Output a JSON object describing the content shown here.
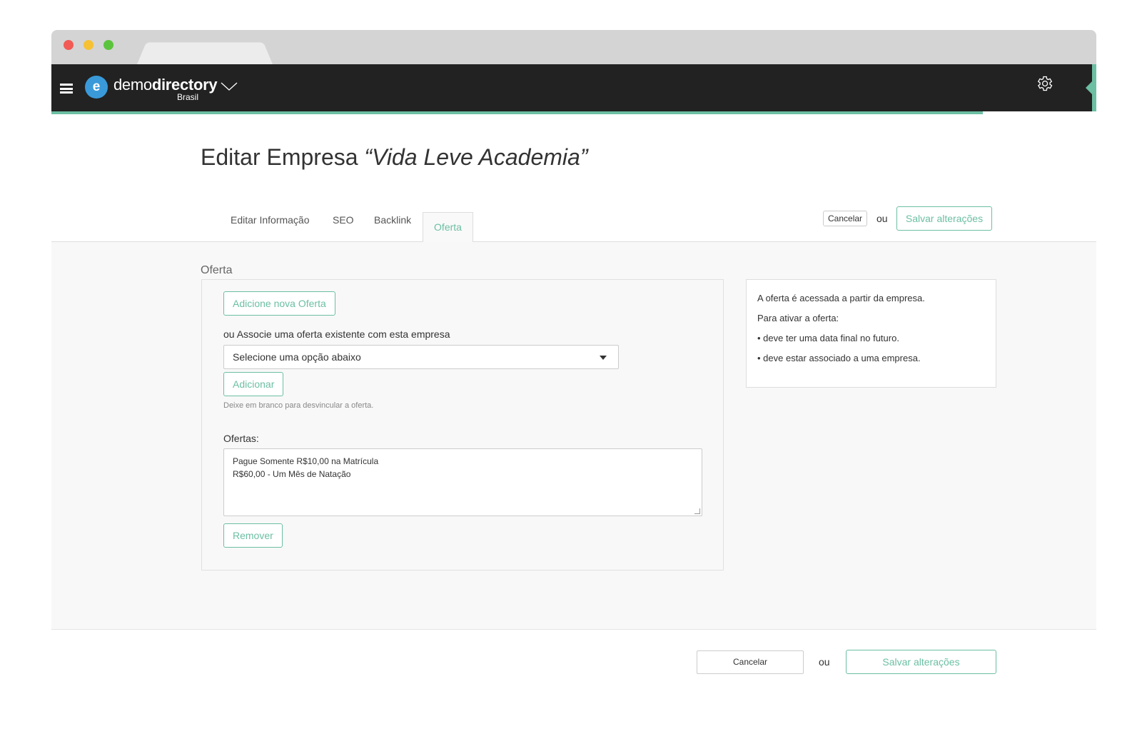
{
  "app": {
    "logo_letter": "e",
    "logo_light": "demo",
    "logo_bold": "directory",
    "logo_sub": "Brasil",
    "accent_color": "#6cbfa2",
    "topbar_color": "#222222",
    "logo_color": "#3a9ad9"
  },
  "page": {
    "title_prefix": "Editar Empresa ",
    "title_name": "“Vida Leve Academia”"
  },
  "tabs": [
    {
      "label": "Editar Informação"
    },
    {
      "label": "SEO"
    },
    {
      "label": "Backlink"
    },
    {
      "label": "Oferta",
      "active": true
    }
  ],
  "top_actions": {
    "cancel_label": "Cancelar",
    "or_label": "ou",
    "save_label": "Salvar alterações"
  },
  "oferta": {
    "section_label": "Oferta",
    "add_new_label": "Adicione nova Oferta",
    "associate_label": "ou Associe uma oferta existente com esta empresa",
    "select_value": "Selecione uma opção abaixo",
    "add_label": "Adicionar",
    "help_text": "Deixe em branco para desvincular a oferta.",
    "ofertas_label": "Ofertas:",
    "items": [
      "Pague Somente R$10,00 na Matrícula",
      "R$60,00 - Um Mês de Natação"
    ],
    "remove_label": "Remover"
  },
  "info": {
    "lines": [
      "A oferta é acessada a partir da empresa.",
      "Para ativar a oferta:",
      "• deve ter uma data final no futuro.",
      "• deve estar associado a uma empresa."
    ]
  },
  "bottom_actions": {
    "cancel_label": "Cancelar",
    "or_label": "ou",
    "save_label": "Salvar alterações"
  }
}
